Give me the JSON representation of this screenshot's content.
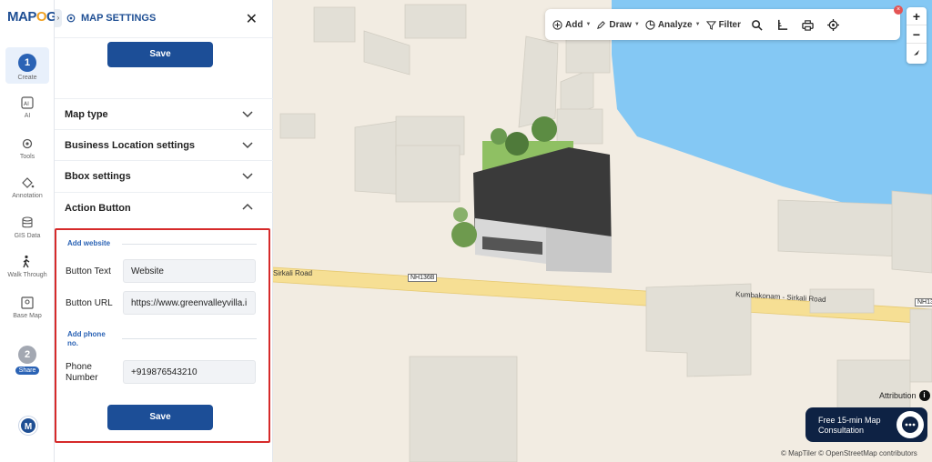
{
  "app": {
    "logo_text": "MAPOG",
    "logo_part1": "MAP",
    "logo_part2": "O",
    "logo_part3": "G"
  },
  "rail": {
    "steps": [
      {
        "number": "1",
        "label": "Create"
      },
      {
        "number": "2",
        "label": "Share"
      }
    ],
    "items": [
      {
        "label": "AI",
        "icon": "ai-icon"
      },
      {
        "label": "Tools",
        "icon": "gear-icon"
      },
      {
        "label": "Annotation",
        "icon": "paint-bucket-icon"
      },
      {
        "label": "GIS Data",
        "icon": "layers-icon"
      },
      {
        "label": "Walk Through",
        "icon": "walking-person-icon"
      },
      {
        "label": "Base Map",
        "icon": "map-icon"
      }
    ],
    "avatar_initial": "M"
  },
  "panel": {
    "title": "MAP SETTINGS",
    "top_save_label": "Save",
    "sections": [
      {
        "label": "Map type",
        "expanded": false
      },
      {
        "label": "Business Location settings",
        "expanded": false
      },
      {
        "label": "Bbox settings",
        "expanded": false
      },
      {
        "label": "Action Button",
        "expanded": true
      }
    ],
    "action_button": {
      "website_section": "Add website",
      "button_text_label": "Button Text",
      "button_text_value": "Website",
      "button_url_label": "Button URL",
      "button_url_value": "https://www.greenvalleyvilla.i",
      "phone_section_line1": "Add phone",
      "phone_section_line2": "no.",
      "phone_label_line1": "Phone",
      "phone_label_line2": "Number",
      "phone_value": "+919876543210",
      "save_label": "Save",
      "highlight_color": "#d62a2a"
    }
  },
  "toolbar": {
    "add": "Add",
    "draw": "Draw",
    "analyze": "Analyze",
    "filter": "Filter",
    "badge": "×"
  },
  "map": {
    "road_labels": [
      {
        "text": "Sirkali Road"
      },
      {
        "text": "Kumbakonam - Sirkali Road"
      }
    ],
    "shields": [
      "NH136B",
      "NH13"
    ],
    "attribution": "Attribution",
    "consult_line1": "Free 15-min Map",
    "consult_line2": "Consultation",
    "copyright": "© MapTiler © OpenStreetMap contributors",
    "colors": {
      "land": "#f2ece2",
      "water": "#84c8f4",
      "road": "#f6df94",
      "building": "#e2dfd6",
      "accent": "#1c4e97"
    }
  }
}
